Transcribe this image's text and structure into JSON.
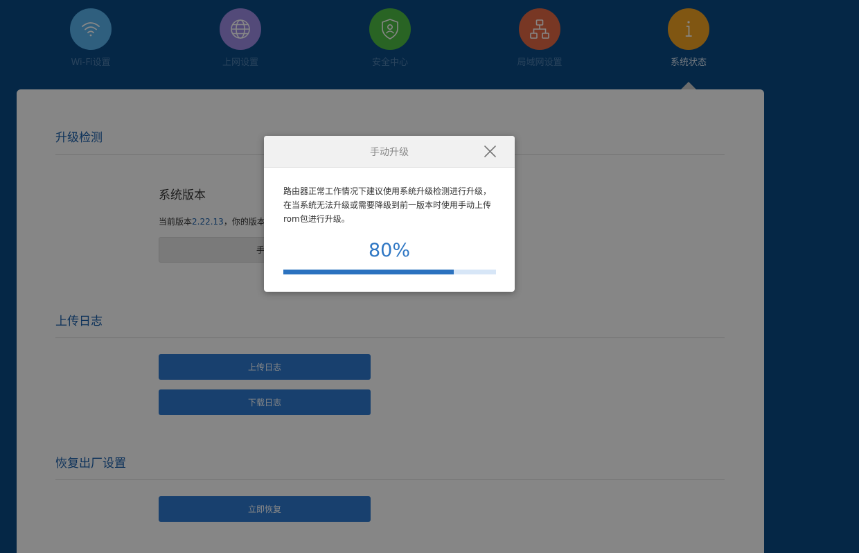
{
  "nav": {
    "items": [
      {
        "label": "Wi-Fi设置",
        "icon": "wifi-icon",
        "color": "#5ab4ee",
        "active": false
      },
      {
        "label": "上网设置",
        "icon": "globe-icon",
        "color": "#9e8ce4",
        "active": false
      },
      {
        "label": "安全中心",
        "icon": "shield-icon",
        "color": "#4fbd45",
        "active": false
      },
      {
        "label": "局域网设置",
        "icon": "network-icon",
        "color": "#e26845",
        "active": false
      },
      {
        "label": "系统状态",
        "icon": "info-icon",
        "color": "#f2a323",
        "active": true
      }
    ]
  },
  "upgrade": {
    "title": "升级检测",
    "version_heading": "系统版本",
    "version_prefix": "当前版本",
    "version_number": "2.22.13",
    "version_suffix": "，你的版本",
    "manual_button": "手动"
  },
  "logs": {
    "title": "上传日志",
    "upload_button": "上传日志",
    "download_button": "下载日志"
  },
  "factory": {
    "title": "恢复出厂设置",
    "restore_button": "立即恢复"
  },
  "modal": {
    "title": "手动升级",
    "description": "路由器正常工作情况下建议使用系统升级检测进行升级，在当系统无法升级或需要降级到前一版本时使用手动上传rom包进行升级。",
    "percent_text": "80%",
    "progress": 0.8
  },
  "colors": {
    "background": "#0a4a85",
    "accent": "#2e7ad0",
    "progress_fill": "#2b72bf",
    "progress_track": "#d7e6f7"
  }
}
